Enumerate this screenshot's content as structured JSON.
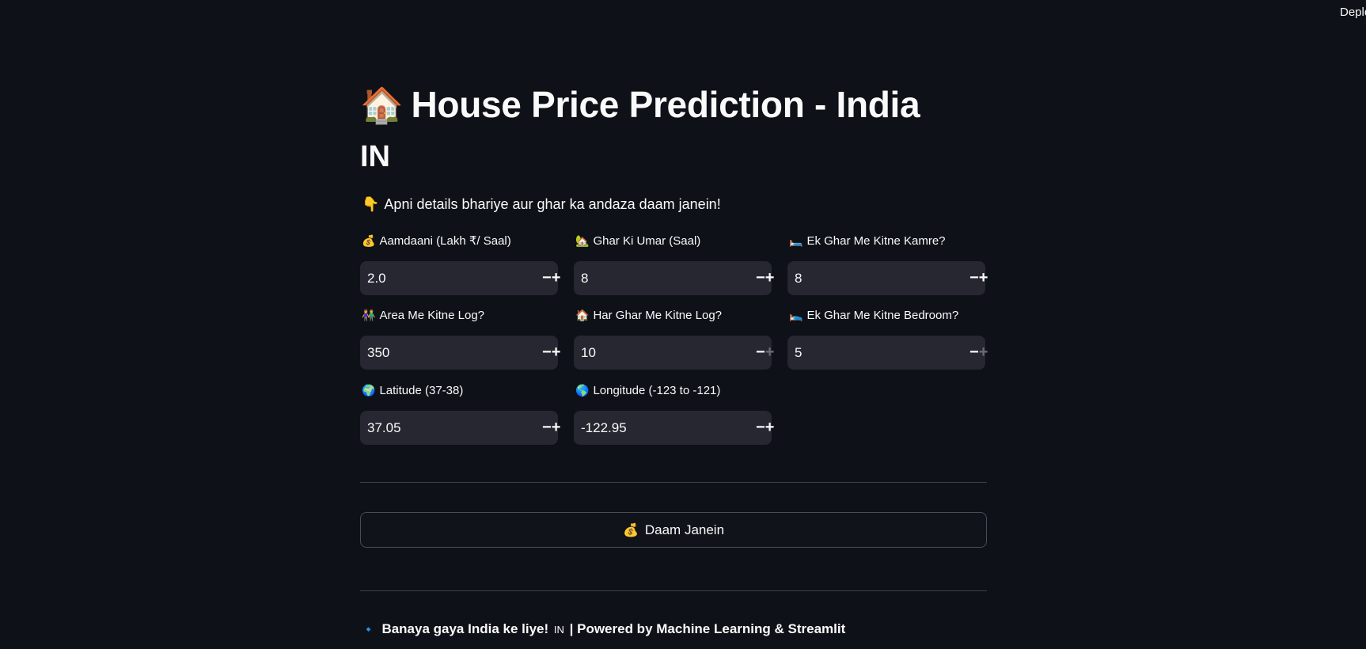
{
  "top_right": {
    "deploy_label": "Deplo"
  },
  "header": {
    "house_emoji": "🏠",
    "title": "House Price Prediction - India",
    "flag_code": "IN"
  },
  "instruction": {
    "emoji": "👇",
    "text": "Apni details bhariye aur ghar ka andaza daam janein!"
  },
  "fields": [
    {
      "emoji": "💰",
      "label": "Aamdaani (Lakh ₹/ Saal)",
      "value": "2.0",
      "plus_disabled": false
    },
    {
      "emoji": "🏡",
      "label": "Ghar Ki Umar (Saal)",
      "value": "8",
      "plus_disabled": false
    },
    {
      "emoji": "🛏️",
      "label": "Ek Ghar Me Kitne Kamre?",
      "value": "8",
      "plus_disabled": false
    },
    {
      "emoji": "👫",
      "label": "Area Me Kitne Log?",
      "value": "350",
      "plus_disabled": false
    },
    {
      "emoji": "🏠",
      "label": "Har Ghar Me Kitne Log?",
      "value": "10",
      "plus_disabled": true
    },
    {
      "emoji": "🛌",
      "label": "Ek Ghar Me Kitne Bedroom?",
      "value": "5",
      "plus_disabled": true
    },
    {
      "emoji": "🌍",
      "label": "Latitude (37-38)",
      "value": "37.05",
      "plus_disabled": false
    },
    {
      "emoji": "🌎",
      "label": "Longitude (-123 to -121)",
      "value": "-122.95",
      "plus_disabled": false
    }
  ],
  "stepper": {
    "minus": "−",
    "plus": "+"
  },
  "predict_button": {
    "emoji": "💰",
    "label": "Daam Janein"
  },
  "footer": {
    "diamond": "🔹",
    "text_before": "Banaya gaya India ke liye!",
    "flag_code": "IN",
    "text_after": "| Powered by Machine Learning & Streamlit"
  }
}
